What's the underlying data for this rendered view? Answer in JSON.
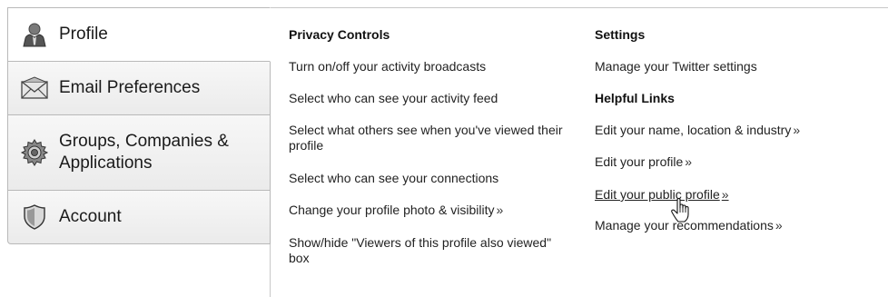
{
  "sidebar": {
    "tabs": [
      {
        "label": "Profile",
        "icon": "profile-person-icon",
        "active": true
      },
      {
        "label": "Email Preferences",
        "icon": "envelope-icon",
        "active": false
      },
      {
        "label": "Groups, Companies &\nApplications",
        "icon": "gear-icon",
        "active": false
      },
      {
        "label": "Account",
        "icon": "shield-icon",
        "active": false
      }
    ]
  },
  "privacy": {
    "heading": "Privacy Controls",
    "items": [
      "Turn on/off your activity broadcasts",
      "Select who can see your activity feed",
      "Select what others see when you've viewed their profile",
      "Select who can see your connections",
      "Change your profile photo & visibility",
      "Show/hide \"Viewers of this profile also viewed\" box"
    ],
    "raquo": "»"
  },
  "settings": {
    "heading": "Settings",
    "items": [
      "Manage your Twitter settings"
    ]
  },
  "helpful_links": {
    "heading": "Helpful Links",
    "items": [
      "Edit your name, location & industry",
      "Edit your profile",
      "Edit your public profile",
      "Manage your recommendations"
    ],
    "raquo": "»"
  }
}
